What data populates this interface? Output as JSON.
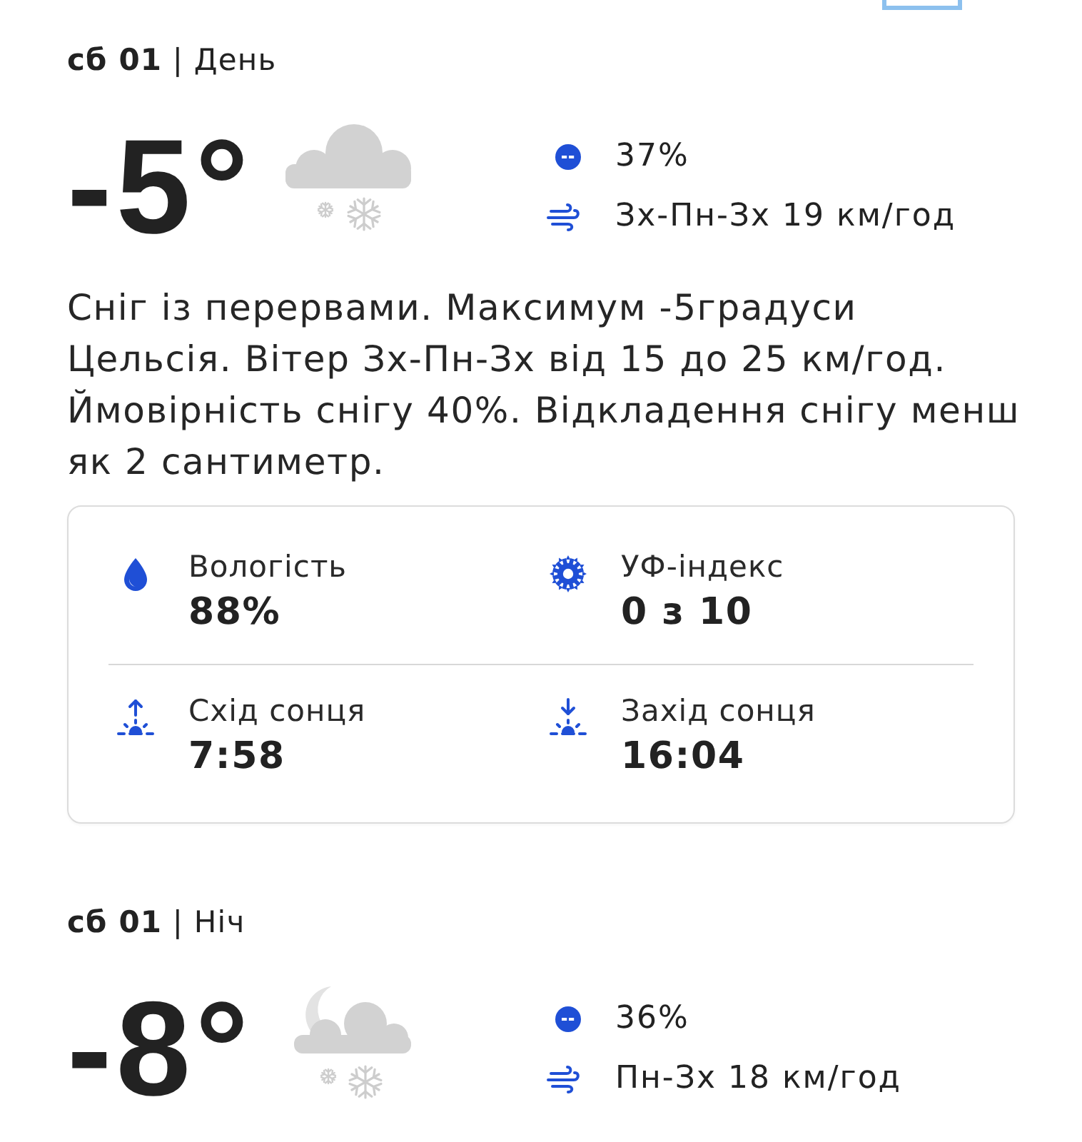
{
  "periods": [
    {
      "kind": "day",
      "title": "**сб 01** | День",
      "temperature": "-5°",
      "precipitation": "37%",
      "wind": "Зх-Пн-Зх 19 км/год",
      "description": "Сніг із перервами. Максимум -5градуси\nЦельсія. Вітер Зх-Пн-Зх від 15 до 25 км/год.\nЙмовірність снігу 40%. Відкладення снігу менш\nяк 2 сантиметр.",
      "details": [
        {
          "kind": "humidity",
          "label": "Вологість",
          "value": "88%"
        },
        {
          "kind": "uv",
          "label": "УФ-індекс",
          "value": "0 з 10"
        },
        {
          "kind": "sunrise",
          "label": "Схід сонця",
          "value": "7:58"
        },
        {
          "kind": "sunset",
          "label": "Захід сонця",
          "value": "16:04"
        }
      ]
    },
    {
      "kind": "night",
      "title": "**сб 01** | Ніч",
      "temperature": "-8°",
      "precipitation": "36%",
      "wind": "Пн-Зх 18 км/год"
    }
  ]
}
